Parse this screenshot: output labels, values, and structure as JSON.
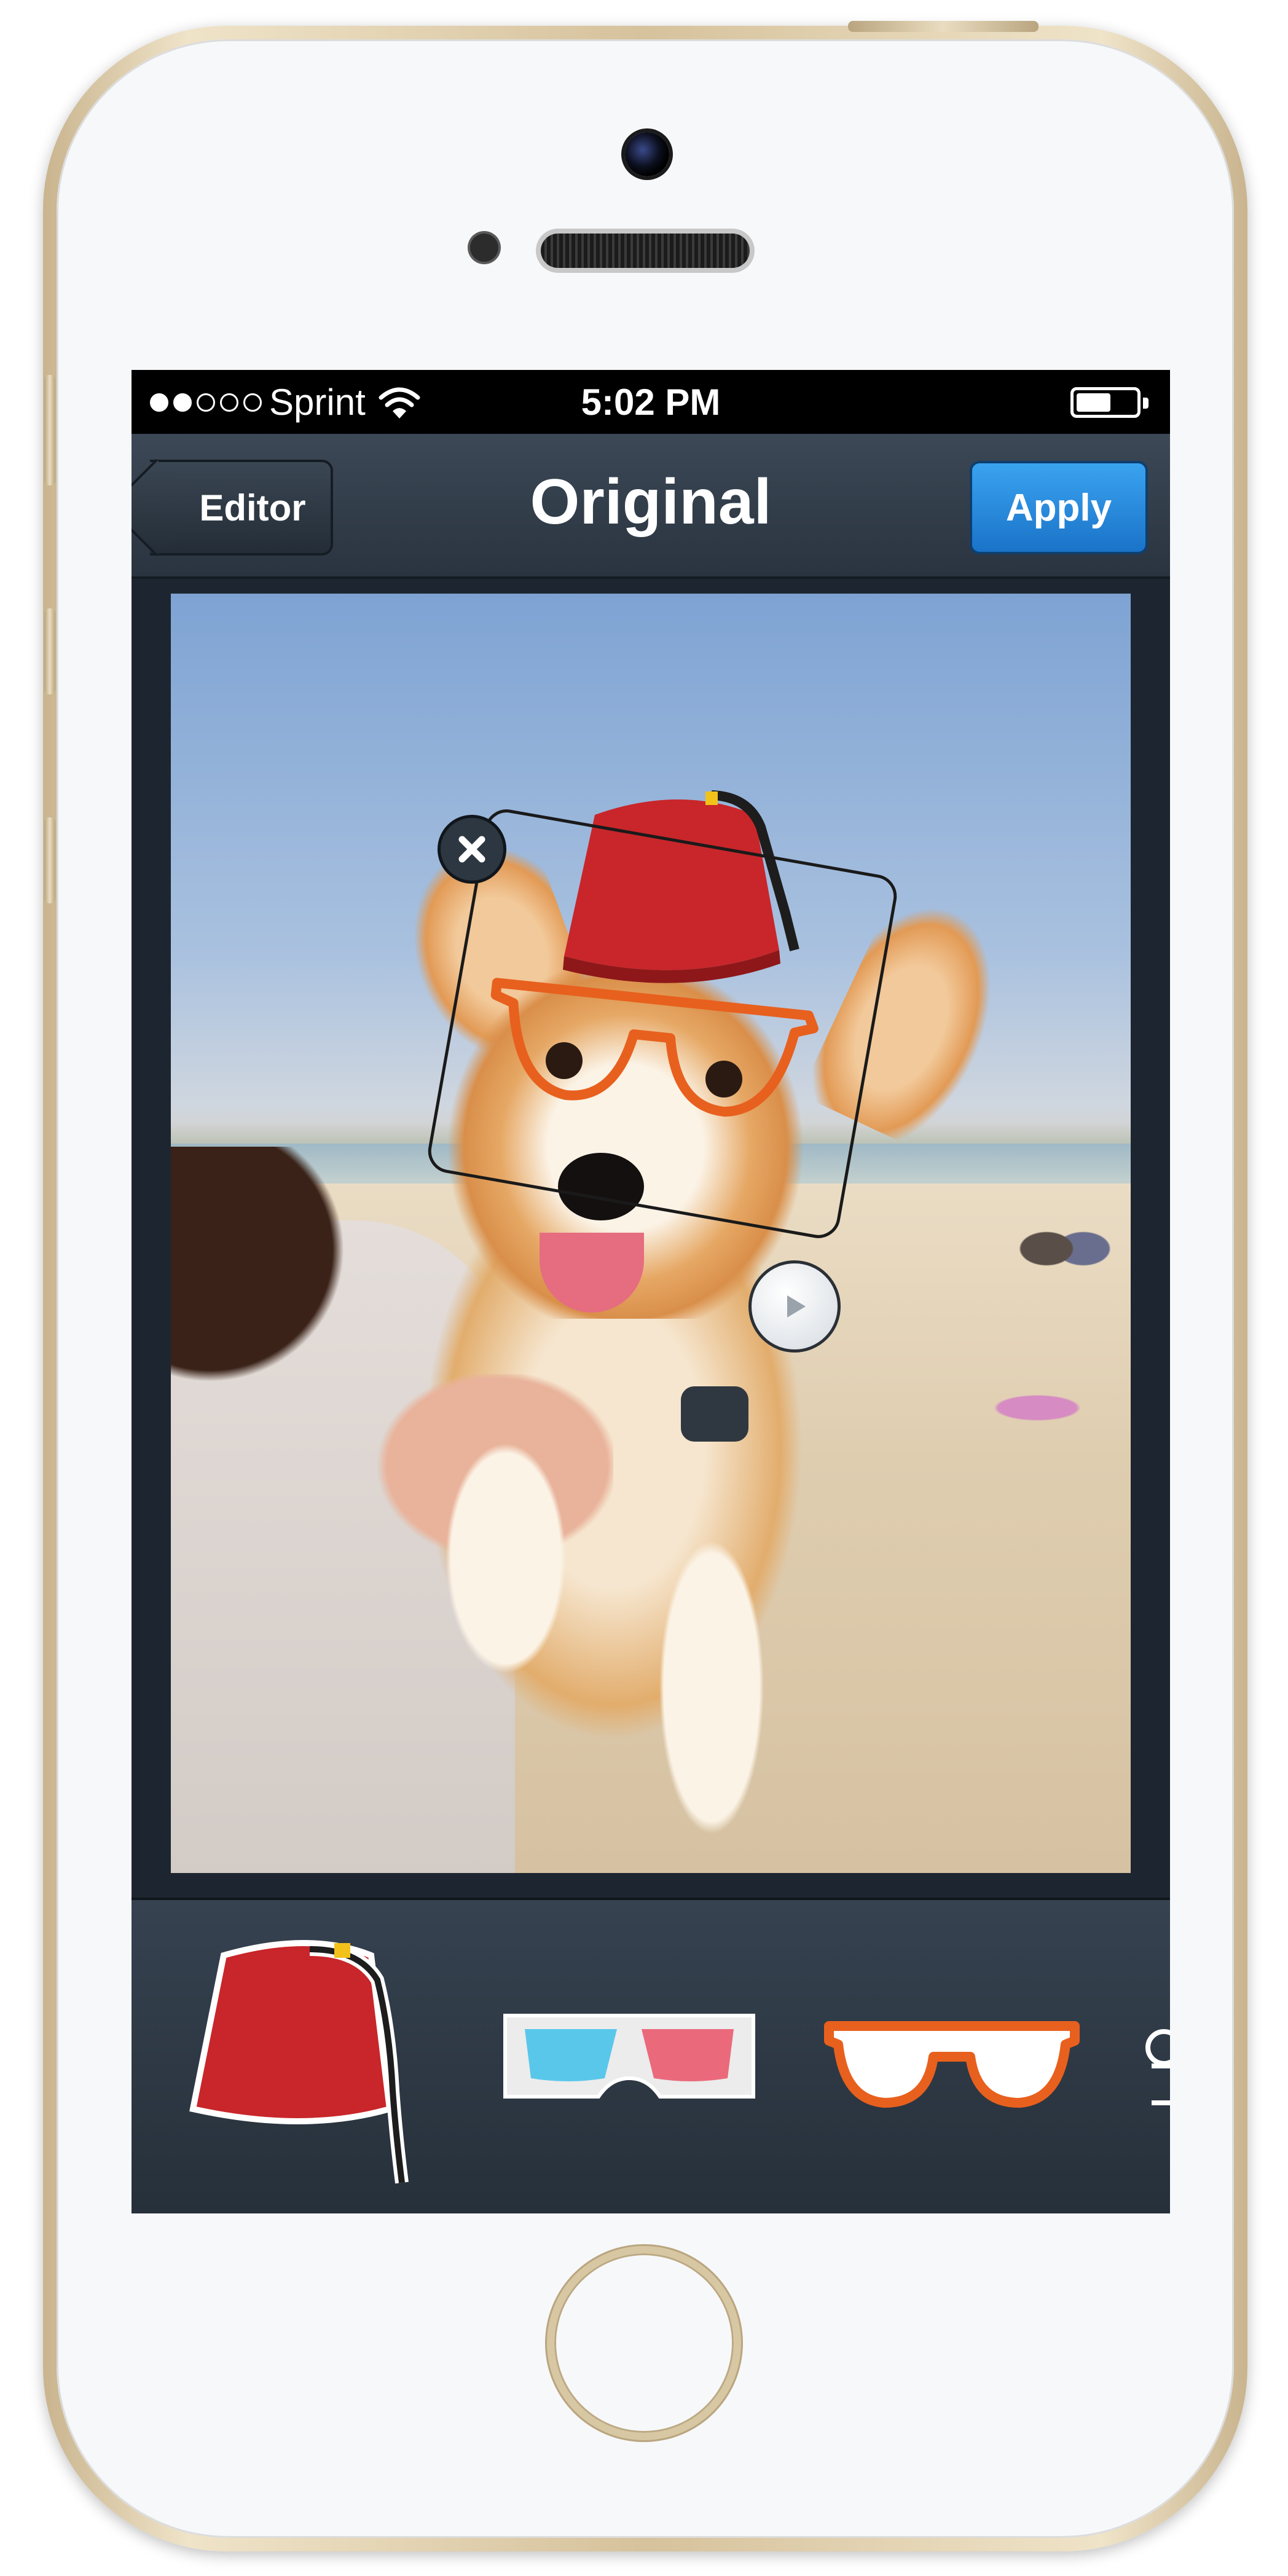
{
  "status_bar": {
    "carrier": "Sprint",
    "time": "5:02 PM",
    "signal_bars_filled": 2,
    "signal_bars_total": 5
  },
  "nav": {
    "back_label": "Editor",
    "title": "Original",
    "apply_label": "Apply"
  },
  "photo_editor": {
    "applied_stickers": [
      "fez-hat",
      "orange-hipster-glasses"
    ],
    "selected_sticker": "fez-hat"
  },
  "sticker_tray": {
    "items": [
      {
        "name": "fez-hat",
        "icon": "fez-icon"
      },
      {
        "name": "3d-glasses",
        "icon": "3d-glasses-icon"
      },
      {
        "name": "orange-glasses",
        "icon": "orange-glasses-icon"
      },
      {
        "name": "more-sticker",
        "icon": "partial-sticker-icon"
      }
    ]
  },
  "colors": {
    "apply_button": "#1a73c8",
    "nav_bar": "#2a3440",
    "fez_red": "#c8262a",
    "glasses_orange": "#e8601e"
  }
}
